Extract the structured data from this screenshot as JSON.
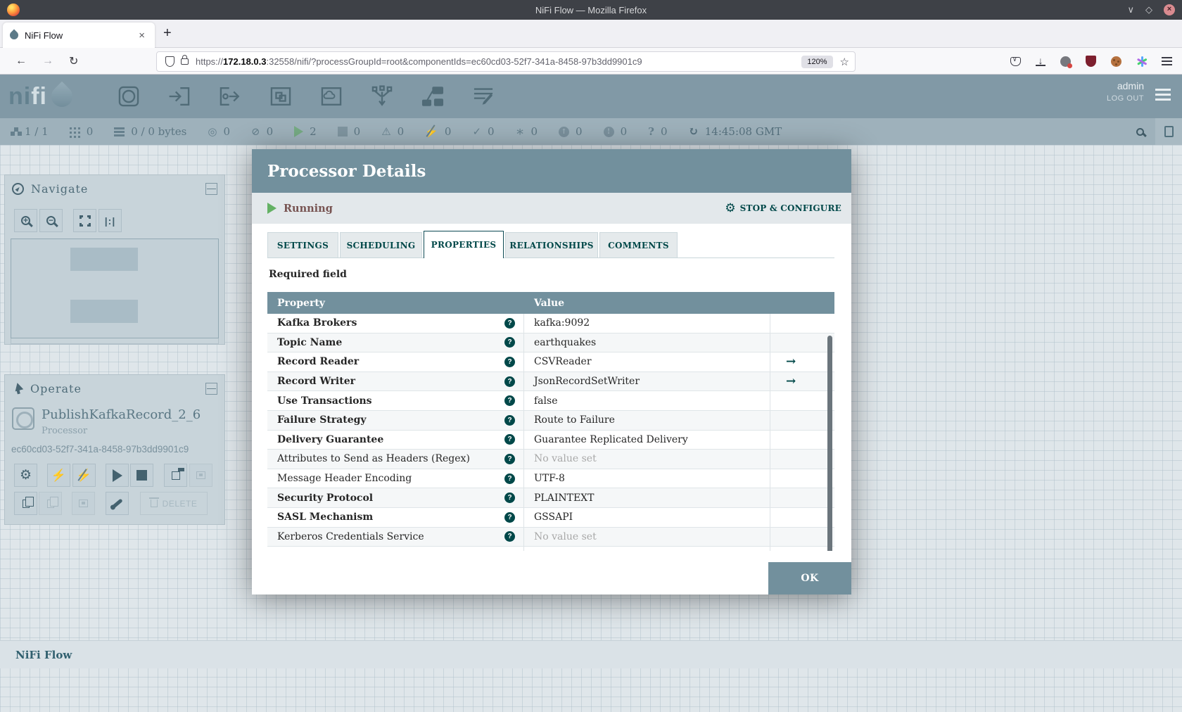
{
  "browser": {
    "window_title": "NiFi Flow — Mozilla Firefox",
    "tab_title": "NiFi Flow",
    "new_tab_label": "+",
    "close_tab_label": "×",
    "url_scheme": "https://",
    "url_host": "172.18.0.3",
    "url_rest": ":32558/nifi/?processGroupId=root&componentIds=ec60cd03-52f7-341a-8458-97b3dd9901c9",
    "zoom_level": "120%",
    "back_glyph": "←",
    "forward_glyph": "→",
    "reload_glyph": "↻",
    "star_glyph": "☆",
    "toolbar_icons": [
      "pocket-icon",
      "download-icon",
      "account-icon",
      "adblock-icon",
      "cookie-icon",
      "extension-icon",
      "menu-icon"
    ],
    "window_controls": [
      "chevron-down",
      "maximize",
      "close"
    ]
  },
  "nifi_header": {
    "logo_text_1": "ni",
    "logo_text_2": "fi",
    "user": "admin",
    "logout_label": "LOG OUT"
  },
  "status_bar": {
    "items": [
      {
        "icon": "cluster-icon",
        "count": "1 / 1"
      },
      {
        "icon": "active-threads-icon",
        "count": "0"
      },
      {
        "icon": "queued-icon",
        "count": "0 / 0 bytes"
      },
      {
        "icon": "transmitting-icon",
        "count": "0"
      },
      {
        "icon": "not-transmitting-icon",
        "count": "0"
      },
      {
        "icon": "running-icon",
        "count": "2"
      },
      {
        "icon": "stopped-icon",
        "count": "0"
      },
      {
        "icon": "invalid-icon",
        "count": "0"
      },
      {
        "icon": "disabled-icon",
        "count": "0"
      },
      {
        "icon": "up-to-date-icon",
        "count": "0"
      },
      {
        "icon": "locally-modified-icon",
        "count": "0"
      },
      {
        "icon": "stale-icon",
        "count": "0"
      },
      {
        "icon": "locally-modified-stale-icon",
        "count": "0"
      },
      {
        "icon": "sync-failure-icon",
        "count": "0"
      }
    ],
    "glyphs": {
      "transmitting": "◎",
      "not_transmitting": "⊘",
      "disabled": "⚡",
      "invalid": "⚠",
      "up_to_date": "✓",
      "locally_modified": "∗",
      "stale": "↑",
      "locally_modified_stale": "!",
      "sync_failure": "?",
      "refresh": "↻"
    },
    "refresh_time": "14:45:08 GMT"
  },
  "navigate": {
    "title": "Navigate",
    "collapse_glyph": "—",
    "zoom_in_glyph": "+",
    "zoom_out_glyph": "−",
    "actual_size_glyph": "|:|"
  },
  "operate": {
    "title": "Operate",
    "collapse_glyph": "—",
    "component_name": "PublishKafkaRecord_2_6",
    "component_type": "Processor",
    "component_id": "ec60cd03-52f7-341a-8458-97b3dd9901c9",
    "delete_label": "DELETE"
  },
  "breadcrumb": "NiFi Flow",
  "modal": {
    "title": "Processor Details",
    "status": "Running",
    "action_label": "STOP & CONFIGURE",
    "action_gear_glyph": "⚙",
    "tabs": [
      {
        "label": "SETTINGS"
      },
      {
        "label": "SCHEDULING"
      },
      {
        "label": "PROPERTIES"
      },
      {
        "label": "RELATIONSHIPS"
      },
      {
        "label": "COMMENTS"
      }
    ],
    "active_tab": "PROPERTIES",
    "required_note": "Required field",
    "table": {
      "columns": {
        "property": "Property",
        "value": "Value"
      },
      "help_glyph": "?",
      "goto_glyph": "→",
      "rows": [
        {
          "property": "Kafka Brokers",
          "value": "kafka:9092",
          "required": true,
          "goto": false
        },
        {
          "property": "Topic Name",
          "value": "earthquakes",
          "required": true,
          "goto": false
        },
        {
          "property": "Record Reader",
          "value": "CSVReader",
          "required": true,
          "goto": true
        },
        {
          "property": "Record Writer",
          "value": "JsonRecordSetWriter",
          "required": true,
          "goto": true
        },
        {
          "property": "Use Transactions",
          "value": "false",
          "required": true,
          "goto": false
        },
        {
          "property": "Failure Strategy",
          "value": "Route to Failure",
          "required": true,
          "goto": false
        },
        {
          "property": "Delivery Guarantee",
          "value": "Guarantee Replicated Delivery",
          "required": true,
          "goto": false
        },
        {
          "property": "Attributes to Send as Headers (Regex)",
          "value": "No value set",
          "required": false,
          "goto": false,
          "unset": true
        },
        {
          "property": "Message Header Encoding",
          "value": "UTF-8",
          "required": false,
          "goto": false
        },
        {
          "property": "Security Protocol",
          "value": "PLAINTEXT",
          "required": true,
          "goto": false
        },
        {
          "property": "SASL Mechanism",
          "value": "GSSAPI",
          "required": true,
          "goto": false
        },
        {
          "property": "Kerberos Credentials Service",
          "value": "No value set",
          "required": false,
          "goto": false,
          "unset": true
        }
      ]
    },
    "ok_label": "OK"
  }
}
